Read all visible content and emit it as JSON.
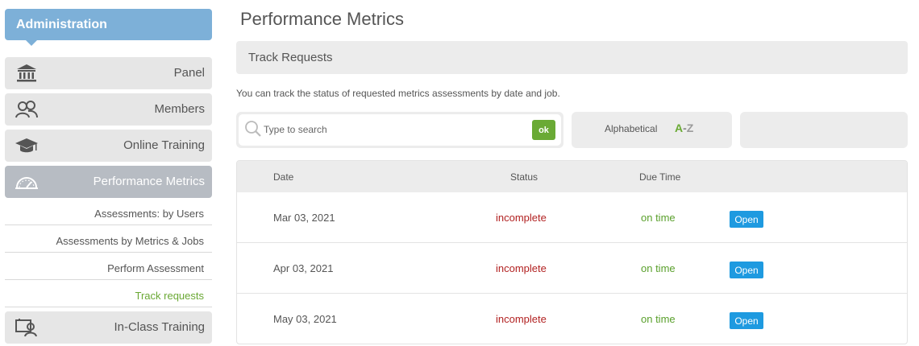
{
  "sidebar": {
    "header": "Administration",
    "items": [
      {
        "label": "Panel",
        "icon": "bank-icon"
      },
      {
        "label": "Members",
        "icon": "members-icon"
      },
      {
        "label": "Online Training",
        "icon": "graduation-cap-icon"
      },
      {
        "label": "Performance Metrics",
        "icon": "speedometer-icon",
        "active": true
      },
      {
        "label": "In-Class Training",
        "icon": "classroom-icon"
      }
    ],
    "subitems": [
      {
        "label": "Assessments: by Users"
      },
      {
        "label": "Assessments by Metrics & Jobs"
      },
      {
        "label": "Perform Assessment"
      },
      {
        "label": "Track requests",
        "current": true
      }
    ]
  },
  "main": {
    "title": "Performance Metrics",
    "section": "Track Requests",
    "description": "You can track the status of requested metrics assessments by date and job.",
    "search": {
      "placeholder": "Type to search",
      "value": "",
      "button": "ok"
    },
    "sort": {
      "label": "Alphabetical",
      "a": "A",
      "dash": "-",
      "z": "Z"
    }
  },
  "table": {
    "headers": {
      "date": "Date",
      "status": "Status",
      "due": "Due Time"
    },
    "rows": [
      {
        "date": "Mar 03, 2021",
        "status": "incomplete",
        "due": "on time",
        "action": "Open"
      },
      {
        "date": "Apr 03, 2021",
        "status": "incomplete",
        "due": "on time",
        "action": "Open"
      },
      {
        "date": "May 03, 2021",
        "status": "incomplete",
        "due": "on time",
        "action": "Open"
      }
    ]
  },
  "colors": {
    "header_blue": "#7db0d8",
    "active_nav": "#b7bcc3",
    "accent_green": "#6aaa35",
    "status_red": "#b22222",
    "button_blue": "#1e9ae0"
  }
}
